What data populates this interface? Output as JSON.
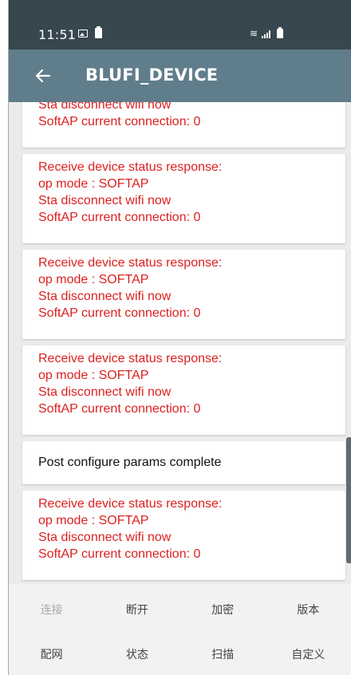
{
  "status_bar": {
    "time": "11:51",
    "battery_icon": "battery-icon",
    "wifi_icon": "wifi-icon",
    "signal_icon": "signal-icon"
  },
  "app_bar": {
    "title": "BLUFI_DEVICE",
    "back_icon": "arrow-left-icon",
    "background": "#607d8b",
    "status_background": "#37474f"
  },
  "log": {
    "text_color": "#dd1f1f",
    "cards": [
      {
        "type": "status",
        "lines": [
          "Sta disconnect wifi now",
          "SoftAP current connection: 0"
        ]
      },
      {
        "type": "status",
        "lines": [
          "Receive device status response:",
          "op mode : SOFTAP",
          "Sta disconnect wifi now",
          "SoftAP current connection: 0"
        ]
      },
      {
        "type": "status",
        "lines": [
          "Receive device status response:",
          "op mode : SOFTAP",
          "Sta disconnect wifi now",
          "SoftAP current connection: 0"
        ]
      },
      {
        "type": "status",
        "lines": [
          "Receive device status response:",
          "op mode : SOFTAP",
          "Sta disconnect wifi now",
          "SoftAP current connection: 0"
        ]
      },
      {
        "type": "normal",
        "lines": [
          "Post configure params complete"
        ]
      },
      {
        "type": "status",
        "lines": [
          "Receive device status response:",
          "op mode : SOFTAP",
          "Sta disconnect wifi now",
          "SoftAP current connection: 0"
        ]
      }
    ]
  },
  "toolbar": {
    "row1": [
      {
        "label": "连接",
        "enabled": false
      },
      {
        "label": "断开",
        "enabled": true
      },
      {
        "label": "加密",
        "enabled": true
      },
      {
        "label": "版本",
        "enabled": true
      }
    ],
    "row2": [
      {
        "label": "配网",
        "enabled": true
      },
      {
        "label": "状态",
        "enabled": true
      },
      {
        "label": "扫描",
        "enabled": true
      },
      {
        "label": "自定义",
        "enabled": true
      }
    ]
  }
}
